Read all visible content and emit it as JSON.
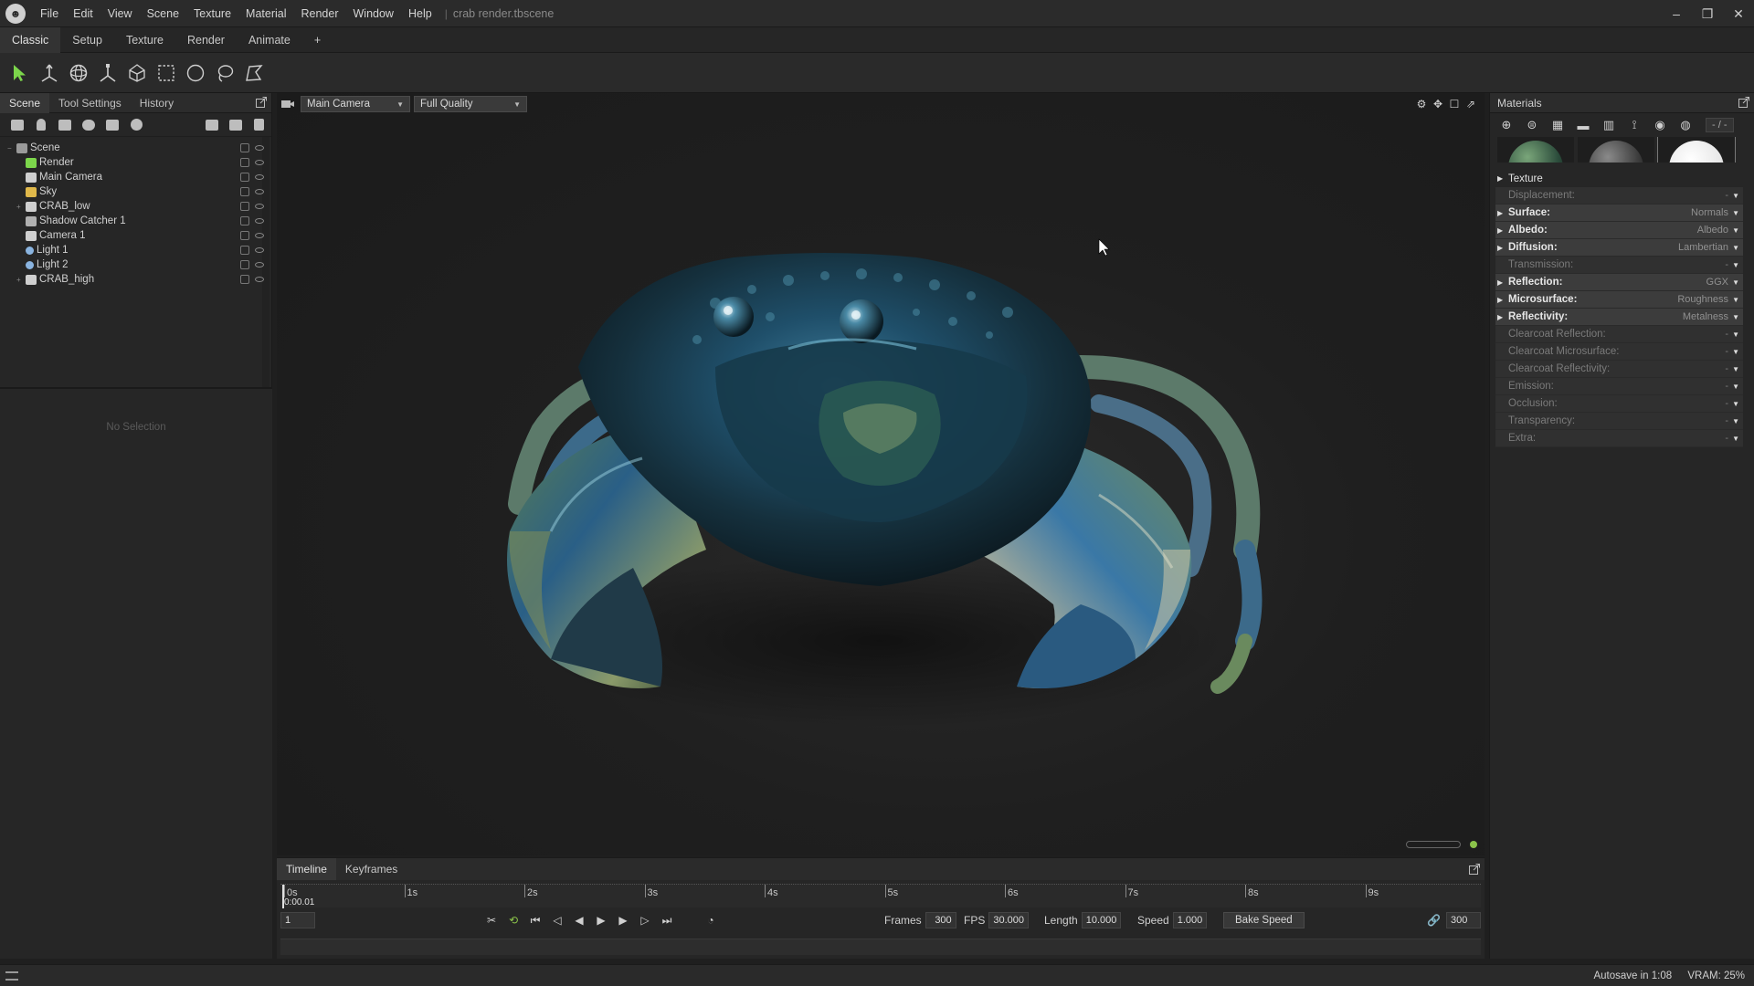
{
  "menu": {
    "items": [
      "File",
      "Edit",
      "View",
      "Scene",
      "Texture",
      "Material",
      "Render",
      "Window",
      "Help"
    ],
    "separator": "|",
    "document_title": "crab render.tbscene"
  },
  "window_controls": {
    "minimize": "–",
    "restore": "❐",
    "close": "✕"
  },
  "workspace_tabs": [
    "Classic",
    "Setup",
    "Texture",
    "Render",
    "Animate",
    "+"
  ],
  "left_panel": {
    "tabs": [
      "Scene",
      "Tool Settings",
      "History"
    ],
    "tree": [
      {
        "label": "Scene",
        "level": 0,
        "icon": "scene-icon"
      },
      {
        "label": "Render",
        "level": 1,
        "icon": "render-icon"
      },
      {
        "label": "Main Camera",
        "level": 1,
        "icon": "camera-icon"
      },
      {
        "label": "Sky",
        "level": 1,
        "icon": "sky-icon"
      },
      {
        "label": "CRAB_low",
        "level": 1,
        "icon": "mesh-icon",
        "expandable": true
      },
      {
        "label": "Shadow Catcher 1",
        "level": 1,
        "icon": "shadow-catcher-icon"
      },
      {
        "label": "Camera 1",
        "level": 1,
        "icon": "camera-icon"
      },
      {
        "label": "Light 1",
        "level": 1,
        "icon": "light-icon"
      },
      {
        "label": "Light 2",
        "level": 1,
        "icon": "light-icon"
      },
      {
        "label": "CRAB_high",
        "level": 1,
        "icon": "mesh-icon",
        "expandable": true
      }
    ],
    "no_selection": "No Selection"
  },
  "viewport": {
    "camera": "Main Camera",
    "quality": "Full Quality"
  },
  "timeline": {
    "tabs": [
      "Timeline",
      "Keyframes"
    ],
    "ticks": [
      "0s",
      "1s",
      "2s",
      "3s",
      "4s",
      "5s",
      "6s",
      "7s",
      "8s",
      "9s"
    ],
    "current_time": "0:00.01",
    "current_frame": "1",
    "frames_label": "Frames",
    "frames": "300",
    "fps_label": "FPS",
    "fps": "30.000",
    "length_label": "Length",
    "length": "10.000",
    "speed_label": "Speed",
    "speed": "1.000",
    "bake_speed": "Bake Speed",
    "end_frame": "300"
  },
  "materials": {
    "title": "Materials",
    "count": "- / -",
    "properties": [
      {
        "label": "Texture",
        "value": "",
        "kind": "section"
      },
      {
        "label": "Displacement:",
        "value": "-",
        "kind": "dim"
      },
      {
        "label": "Surface:",
        "value": "Normals",
        "kind": "active"
      },
      {
        "label": "Albedo:",
        "value": "Albedo",
        "kind": "active"
      },
      {
        "label": "Diffusion:",
        "value": "Lambertian",
        "kind": "active"
      },
      {
        "label": "Transmission:",
        "value": "-",
        "kind": "dim"
      },
      {
        "label": "Reflection:",
        "value": "GGX",
        "kind": "active"
      },
      {
        "label": "Microsurface:",
        "value": "Roughness",
        "kind": "active"
      },
      {
        "label": "Reflectivity:",
        "value": "Metalness",
        "kind": "active"
      },
      {
        "label": "Clearcoat Reflection:",
        "value": "-",
        "kind": "dim"
      },
      {
        "label": "Clearcoat Microsurface:",
        "value": "-",
        "kind": "dim"
      },
      {
        "label": "Clearcoat Reflectivity:",
        "value": "-",
        "kind": "dim"
      },
      {
        "label": "Emission:",
        "value": "-",
        "kind": "dim"
      },
      {
        "label": "Occlusion:",
        "value": "-",
        "kind": "dim"
      },
      {
        "label": "Transparency:",
        "value": "-",
        "kind": "dim"
      },
      {
        "label": "Extra:",
        "value": "-",
        "kind": "dim"
      }
    ]
  },
  "status": {
    "autosave": "Autosave in 1:08",
    "vram": "VRAM: 25%"
  },
  "colors": {
    "accent_green": "#8bc34a",
    "selection_green": "#7cd64b"
  }
}
